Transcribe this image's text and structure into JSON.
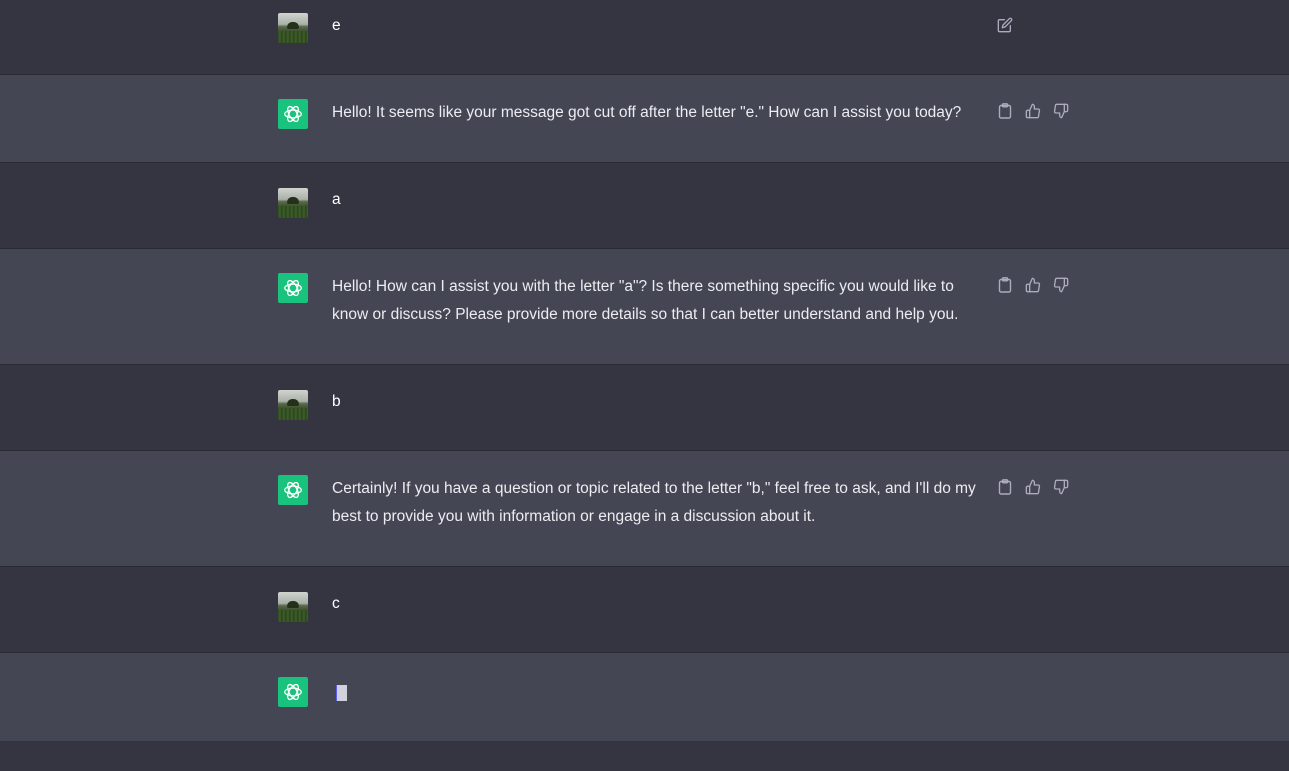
{
  "conversation": {
    "messages": [
      {
        "role": "user",
        "text": "e"
      },
      {
        "role": "assistant",
        "lines": [
          "Hello! It seems like your message got cut off after the letter \"e.\" How can I assist you today?"
        ]
      },
      {
        "role": "user",
        "text": "a"
      },
      {
        "role": "assistant",
        "lines": [
          "Hello! How can I assist you with the letter \"a\"? Is there something specific you would like to",
          "know or discuss? Please provide more details so that I can better understand and help you."
        ]
      },
      {
        "role": "user",
        "text": "b"
      },
      {
        "role": "assistant",
        "lines": [
          "Certainly! If you have a question or topic related to the letter \"b,\" feel free to ask, and I'll do my",
          "best to provide you with information or engage in a discussion about it."
        ]
      },
      {
        "role": "user",
        "text": "c"
      },
      {
        "role": "assistant",
        "lines": [],
        "streaming": true
      }
    ]
  },
  "icons": {
    "edit": "edit-icon",
    "copy": "clipboard-icon",
    "like": "thumbs-up-icon",
    "dislike": "thumbs-down-icon",
    "assistant_logo": "openai-logo-icon",
    "user_avatar": "user-avatar"
  },
  "colors": {
    "user_row_bg": "#343541",
    "assistant_row_bg": "#444654",
    "assistant_avatar_bg": "#19c37d",
    "icon_color": "#acacbe",
    "text_color": "#ececf1"
  }
}
